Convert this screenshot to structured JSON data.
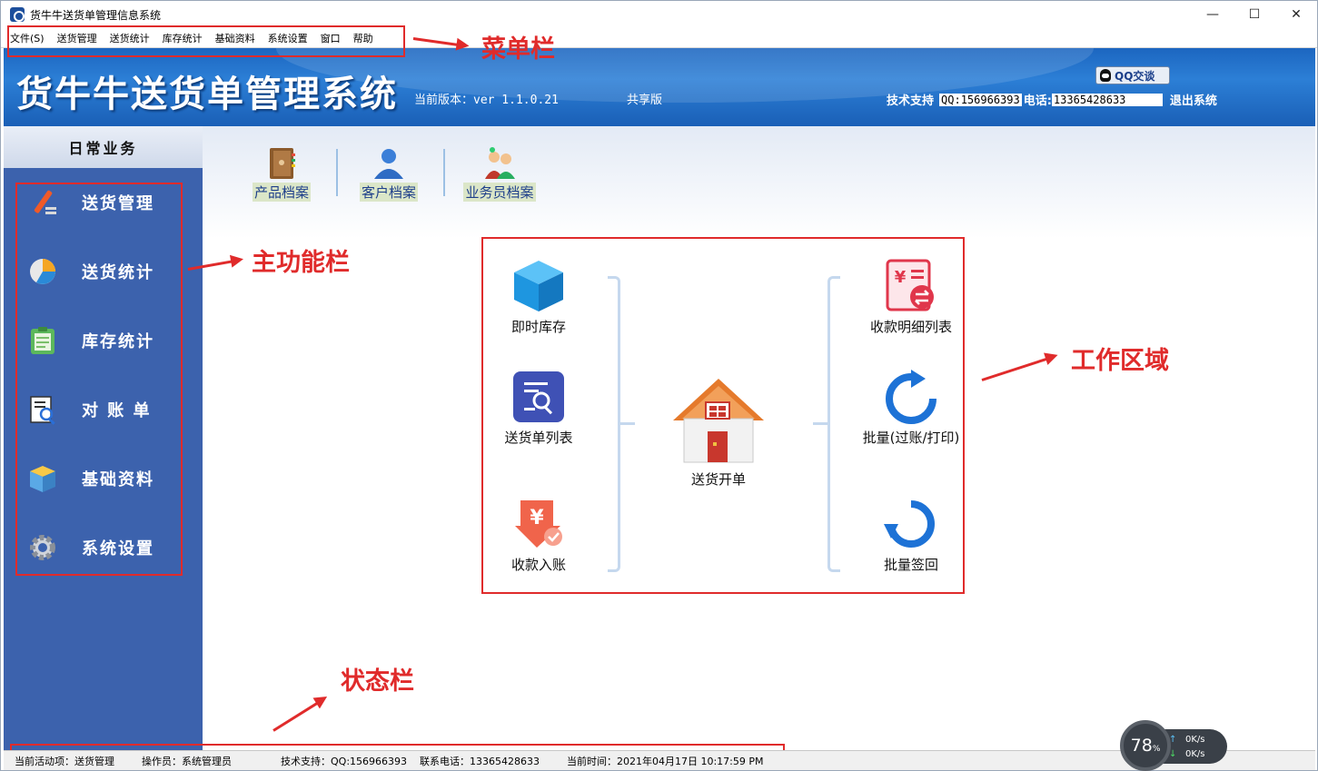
{
  "window": {
    "title": "货牛牛送货单管理信息系统",
    "controls": [
      "—",
      "☐",
      "✕"
    ]
  },
  "menubar": {
    "items": [
      "文件(S)",
      "送货管理",
      "送货统计",
      "库存统计",
      "基础资料",
      "系统设置",
      "窗口",
      "帮助"
    ]
  },
  "banner": {
    "title": "货牛牛送货单管理系统",
    "version": "当前版本：ver 1.1.0.21",
    "edition": "共享版",
    "qq_badge": "QQ交谈",
    "support_label": "技术支持",
    "support_qq": "QQ:156966393",
    "tel_label": "电话:",
    "tel_value": "13365428633",
    "exit": "退出系统"
  },
  "sidebar": {
    "header": "日常业务",
    "items": [
      {
        "label": "送货管理",
        "icon": "pencil-icon"
      },
      {
        "label": "送货统计",
        "icon": "pie-chart-icon"
      },
      {
        "label": "库存统计",
        "icon": "clipboard-icon"
      },
      {
        "label": "对 账 单",
        "icon": "document-search-icon"
      },
      {
        "label": "基础资料",
        "icon": "box-icon"
      },
      {
        "label": "系统设置",
        "icon": "gear-icon"
      }
    ]
  },
  "shortcuts": [
    {
      "label": "产品档案",
      "icon": "notebook-icon"
    },
    {
      "label": "客户档案",
      "icon": "users-icon"
    },
    {
      "label": "业务员档案",
      "icon": "staff-icon"
    }
  ],
  "workarea": {
    "left": [
      {
        "label": "即时库存",
        "icon": "cube-icon"
      },
      {
        "label": "送货单列表",
        "icon": "list-search-icon"
      },
      {
        "label": "收款入账",
        "icon": "yen-receipt-icon"
      }
    ],
    "center": {
      "label": "送货开单",
      "icon": "house-icon"
    },
    "right": [
      {
        "label": "收款明细列表",
        "icon": "receipt-exchange-icon"
      },
      {
        "label": "批量(过账/打印)",
        "icon": "refresh-arrow-icon"
      },
      {
        "label": "批量签回",
        "icon": "return-arrow-icon"
      }
    ]
  },
  "annotations": {
    "menubar": "菜单栏",
    "mainbar": "主功能栏",
    "workarea": "工作区域",
    "statusbar": "状态栏"
  },
  "statusbar": {
    "active": "当前活动项：送货管理",
    "operator": "操作员：系统管理员",
    "support": "技术支持：QQ:156966393",
    "phone": "联系电话：13365428633",
    "time": "当前时间：2021年04月17日 10:17:59 PM"
  },
  "netmeter": {
    "percent": "78",
    "unit": "%",
    "up": "0K/s",
    "down": "0K/s"
  },
  "colors": {
    "accent_red": "#e02b2b",
    "sidebar_blue": "#3c62ad",
    "banner_blue": "#2c7fd6"
  }
}
